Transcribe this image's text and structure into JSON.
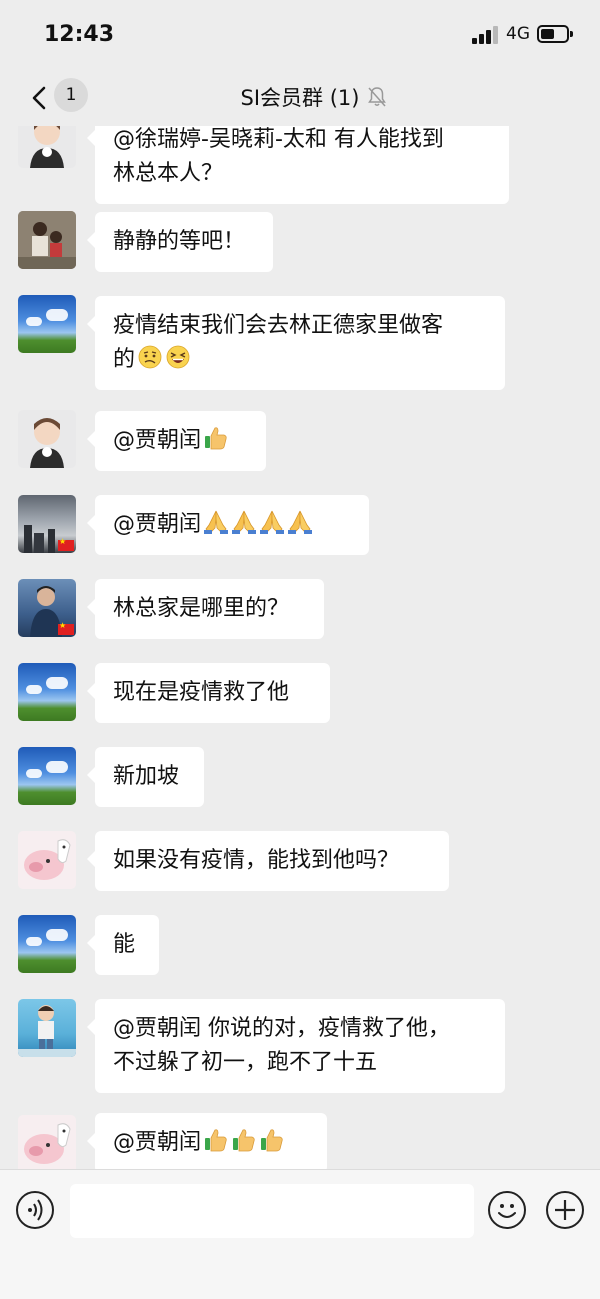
{
  "status_bar": {
    "time": "12:43",
    "network": "4G",
    "battery_level": 0.45
  },
  "nav": {
    "unread_count": "1",
    "title": "SI会员群 (1)"
  },
  "messages": [
    {
      "lines": [
        "@徐瑞婷-吴晓莉-太和 有人能找到",
        "林总本人？"
      ],
      "avatar": "baby-icon"
    },
    {
      "lines": [
        "静静的等吧！"
      ],
      "avatar": "family-photo"
    },
    {
      "lines": [
        "疫情结束我们会去林正德家里做客",
        "的"
      ],
      "avatar": "sky-landscape",
      "emojis": [
        "confused-face-emoji",
        "squinting-grin-emoji"
      ]
    },
    {
      "lines": [
        "@贾朝闰"
      ],
      "avatar": "baby-icon",
      "emojis": [
        "thumbs-up-emoji"
      ]
    },
    {
      "lines": [
        "@贾朝闰"
      ],
      "avatar": "dusk-skyline",
      "emojis": [
        "folded-hands-emoji",
        "folded-hands-emoji",
        "folded-hands-emoji",
        "folded-hands-emoji"
      ]
    },
    {
      "lines": [
        "林总家是哪里的？"
      ],
      "avatar": "man-portrait"
    },
    {
      "lines": [
        "现在是疫情救了他"
      ],
      "avatar": "sky-landscape"
    },
    {
      "lines": [
        "新加坡"
      ],
      "avatar": "sky-landscape"
    },
    {
      "lines": [
        "如果没有疫情，能找到他吗？"
      ],
      "avatar": "cartoon-pig"
    },
    {
      "lines": [
        "能"
      ],
      "avatar": "sky-landscape"
    },
    {
      "lines": [
        "@贾朝闰 你说的对，疫情救了他，",
        "不过躲了初一，跑不了十五"
      ],
      "avatar": "kid-portrait"
    },
    {
      "lines": [
        "@贾朝闰"
      ],
      "avatar": "cartoon-pig",
      "emojis": [
        "thumbs-up-emoji",
        "thumbs-up-emoji",
        "thumbs-up-emoji"
      ]
    }
  ],
  "input": {
    "placeholder": ""
  }
}
